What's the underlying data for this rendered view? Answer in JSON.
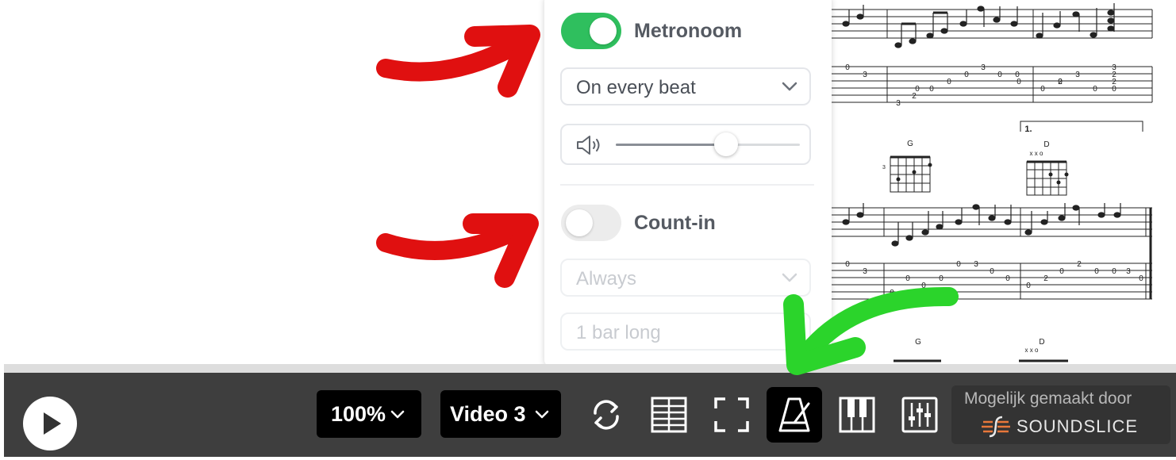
{
  "settings": {
    "metronome": {
      "label": "Metronoom",
      "enabled": true
    },
    "beat_select": {
      "value": "On every beat"
    },
    "volume": {
      "level": 0.6
    },
    "count_in": {
      "label": "Count-in",
      "enabled": false
    },
    "count_in_select": {
      "value": "Always"
    },
    "count_in_length": {
      "value": "1 bar long"
    }
  },
  "toolbar": {
    "zoom": "100%",
    "video": "Video 3",
    "icons": [
      "play-icon",
      "loop-icon",
      "tablature-icon",
      "fullscreen-icon",
      "metronome-icon",
      "piano-icon",
      "mixer-icon"
    ]
  },
  "branding": {
    "made_by": "Mogelijk gemaakt door",
    "name": "SOUNDSLICE"
  },
  "score": {
    "chords": [
      "G",
      "D",
      "G",
      "D"
    ],
    "chord_marks": [
      "x x o",
      "x x o"
    ],
    "fret_label": "3",
    "ending_label": "1.",
    "tab_row1_top": [
      "0",
      "3",
      "0",
      "3",
      "2",
      "3"
    ],
    "tab_row1_mid": [
      "3",
      "0",
      "0",
      "0",
      "0",
      "2",
      "0",
      "2"
    ],
    "tab_row1_low": [
      "0",
      "0",
      "0",
      "0",
      "0"
    ],
    "tab_row1_bottom": [
      "3",
      "2"
    ],
    "tab_row2_top": [
      "0",
      "0",
      "3",
      "2"
    ],
    "tab_row2_mid": [
      "3",
      "0",
      "0",
      "0",
      "0",
      "0",
      "2",
      "0",
      "3"
    ],
    "tab_row2_low": [
      "0",
      "0",
      "0",
      "0",
      "0"
    ]
  },
  "colors": {
    "toggle_on": "#2fbf5e",
    "toolbar_bg": "#3e3e3e",
    "arrow_red": "#e01010",
    "arrow_green": "#2bd42b"
  }
}
